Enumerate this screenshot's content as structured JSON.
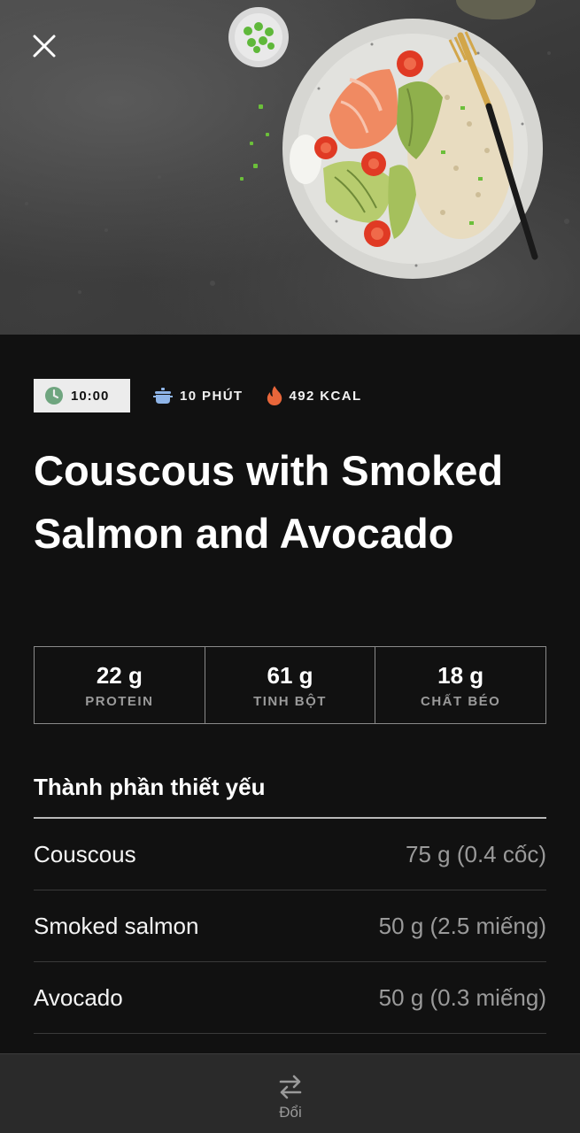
{
  "meta": {
    "timer": "10:00",
    "prep_time": "10 PHÚT",
    "calories": "492 KCAL"
  },
  "recipe": {
    "title": "Couscous with Smoked Salmon and Avocado"
  },
  "macros": [
    {
      "value": "22 g",
      "label": "PROTEIN"
    },
    {
      "value": "61 g",
      "label": "TINH BỘT"
    },
    {
      "value": "18 g",
      "label": "CHẤT BÉO"
    }
  ],
  "ingredients": {
    "heading": "Thành phần thiết yếu",
    "items": [
      {
        "name": "Couscous",
        "quantity": "75 g (0.4 cốc)"
      },
      {
        "name": "Smoked salmon",
        "quantity": "50 g (2.5 miếng)"
      },
      {
        "name": "Avocado",
        "quantity": "50 g (0.3 miếng)"
      }
    ]
  },
  "bottom_bar": {
    "swap_label": "Đổi"
  },
  "icons": {
    "close": "close-icon",
    "timer": "clock-icon",
    "prep": "pot-icon",
    "calories": "flame-icon",
    "swap": "swap-arrows-icon"
  },
  "colors": {
    "background": "#111111",
    "timer_chip": "#ececec",
    "clock_green": "#6fa57f",
    "pot_blue": "#8fb5e8",
    "flame_orange": "#e8663a",
    "muted_text": "#9a9a9a"
  }
}
